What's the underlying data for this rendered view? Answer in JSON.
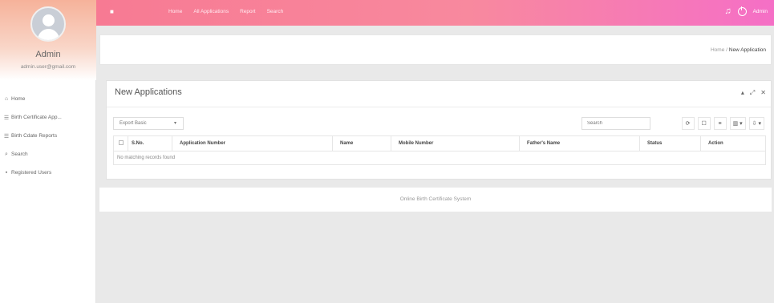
{
  "sidebar": {
    "admin_name": "Admin",
    "admin_email": "admin.user@gmail.com",
    "items": [
      {
        "icon": "home-icon",
        "glyph": "⌂",
        "label": "Home"
      },
      {
        "icon": "birth-certificate-icon",
        "glyph": "☰",
        "label": "Birth Certificate App..."
      },
      {
        "icon": "reports-icon",
        "glyph": "☰",
        "label": "Birth Cdate Reports"
      },
      {
        "icon": "search-icon",
        "glyph": "⌕",
        "label": "Search"
      },
      {
        "icon": "users-icon",
        "glyph": "▪",
        "label": "Registered Users"
      }
    ]
  },
  "topbar": {
    "menu": [
      "Home",
      "All Applications",
      "Report",
      "Search"
    ],
    "admin_label": "Admin"
  },
  "breadcrumb": {
    "home": "Home",
    "separator": "/",
    "current": "New Application"
  },
  "panel": {
    "title": "New Applications",
    "tools": [
      "▴",
      "⤢",
      "✕"
    ],
    "export_label": "Export Basic",
    "search_placeholder": "Search",
    "toolbar_buttons": [
      {
        "icon": "refresh-icon",
        "glyph": "⟳"
      },
      {
        "icon": "toggle-icon",
        "glyph": "☐"
      },
      {
        "icon": "list-icon",
        "glyph": "≡"
      },
      {
        "icon": "columns-icon",
        "glyph": "▥ ▾"
      },
      {
        "icon": "export-icon",
        "glyph": "⇩ ▾"
      }
    ]
  },
  "table": {
    "columns": [
      "S.No.",
      "Application Number",
      "Name",
      "Mobile Number",
      "Father's Name",
      "Status",
      "Action"
    ],
    "empty_message": "No matching records found"
  },
  "footer": {
    "text": "Online Birth Certificate System"
  },
  "colors": {
    "topbar_start": "#f77a93",
    "topbar_end": "#f56fc6"
  }
}
